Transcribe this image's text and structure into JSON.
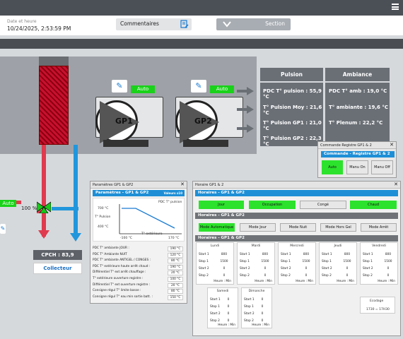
{
  "header": {
    "date_label": "Date et heure",
    "date_value": "10/24/2025, 2:53:59 PM",
    "comments_label": "Commentaires",
    "section_label": "Section"
  },
  "pumps": [
    {
      "name": "GP1",
      "mode": "Auto"
    },
    {
      "name": "GP2",
      "mode": "Auto"
    }
  ],
  "pulsion": {
    "title": "Pulsion",
    "rows": [
      "PDC T° pulsion : 55,9 °C",
      "T° Pulsion Moy : 21,6 °C",
      "T° Pulsion GP1 : 21,0 °C",
      "T° Pulsion GP2 : 22,3 °C"
    ]
  },
  "ambiance": {
    "title": "Ambiance",
    "rows": [
      "PDC T° amb : 19,0 °C",
      "T° ambiante : 19,6 °C",
      "T° Plenum : 22,2 °C"
    ]
  },
  "valve": {
    "mode": "Auto",
    "percent": "100 %"
  },
  "cpch": {
    "label": "CPCH : 83,9",
    "collector": "Collecteur"
  },
  "cmd_win": {
    "title": "Commande Registre GP1 & 2",
    "bar": "Commande - Registre GP1 & 2",
    "buttons": [
      "Auto",
      "Manu On",
      "Manu Off"
    ]
  },
  "param_win": {
    "title": "Paramètres GP1 & GP2",
    "bar": "Paramètres - GP1 & GP2",
    "bar_right": "Valeurs x10",
    "chart": {
      "y_title": "T° Pulsion",
      "x_title": "T° extérieure",
      "top_label": "PDC T° pulsion",
      "y_ticks": [
        "700 °C",
        "400 °C"
      ],
      "x_ticks": [
        "-100 °C",
        "170 °C"
      ]
    },
    "rows": [
      [
        "PDC T° ambiante JOUR :",
        "190 °C"
      ],
      [
        "PDC T° Ambiante NUIT",
        "120 °C"
      ],
      [
        "PDC T° ambiante ANTIGEL / CONGES :",
        "80 °C"
      ],
      [
        "PDC T° extérieure haute arrêt chaud :",
        "190 °C"
      ],
      [
        "Différentiel T° ext arrêt chauffage :",
        "20 °C"
      ],
      [
        "T° extérieure ouverture registre :",
        "100 °C"
      ],
      [
        "Différentiel T° ext ouverture registre :",
        "20 °C"
      ],
      [
        "Consigne régul T° limite basse :",
        "80 °C"
      ],
      [
        "Consigne régul T° eau min sortie batt. :",
        "150 °C"
      ]
    ]
  },
  "hor_win": {
    "title": "Horaire GP1 & 2",
    "bar1": "Horaires - GP1 & GP2",
    "bar2": "Horaires - GP1 & GP2",
    "bar3": "Horaires - GP1 & GP2",
    "modes1": [
      "Jour",
      "Occupation",
      "Congé",
      "Chaud"
    ],
    "modes2": [
      "Mode Automatique",
      "Mode Jour",
      "Mode Nuit",
      "Mode Hors Gel",
      "Mode Arrêt"
    ],
    "days": [
      {
        "name": "Lundi",
        "rows": [
          [
            "Start 1",
            "800"
          ],
          [
            "Stop 1",
            "1500"
          ],
          [
            "Start 2",
            "0"
          ],
          [
            "Stop 2",
            "0"
          ]
        ]
      },
      {
        "name": "Mardi",
        "rows": [
          [
            "Start 1",
            "800"
          ],
          [
            "Stop 1",
            "1500"
          ],
          [
            "Start 2",
            "0"
          ],
          [
            "Stop 2",
            "0"
          ]
        ]
      },
      {
        "name": "Mercredi",
        "rows": [
          [
            "Start 1",
            "800"
          ],
          [
            "Stop 1",
            "1500"
          ],
          [
            "Start 2",
            "0"
          ],
          [
            "Stop 2",
            "0"
          ]
        ]
      },
      {
        "name": "Jeudi",
        "rows": [
          [
            "Start 1",
            "800"
          ],
          [
            "Stop 1",
            "1500"
          ],
          [
            "Start 2",
            "0"
          ],
          [
            "Stop 2",
            "0"
          ]
        ]
      },
      {
        "name": "Vendredi",
        "rows": [
          [
            "Start 1",
            "800"
          ],
          [
            "Stop 1",
            "1500"
          ],
          [
            "Start 2",
            "0"
          ],
          [
            "Stop 2",
            "0"
          ]
        ]
      },
      {
        "name": "Samedi",
        "rows": [
          [
            "Start 1",
            "0"
          ],
          [
            "Stop 1",
            "0"
          ],
          [
            "Start 2",
            "0"
          ],
          [
            "Stop 2",
            "0"
          ]
        ]
      },
      {
        "name": "Dimanche",
        "rows": [
          [
            "Start 1",
            "0"
          ],
          [
            "Stop 1",
            "0"
          ],
          [
            "Start 2",
            "0"
          ],
          [
            "Stop 2",
            "0"
          ]
        ]
      }
    ],
    "hm": "Heure : Min",
    "ecodage": "Ecodage",
    "ecodage_val": "1730 = 17H30"
  }
}
